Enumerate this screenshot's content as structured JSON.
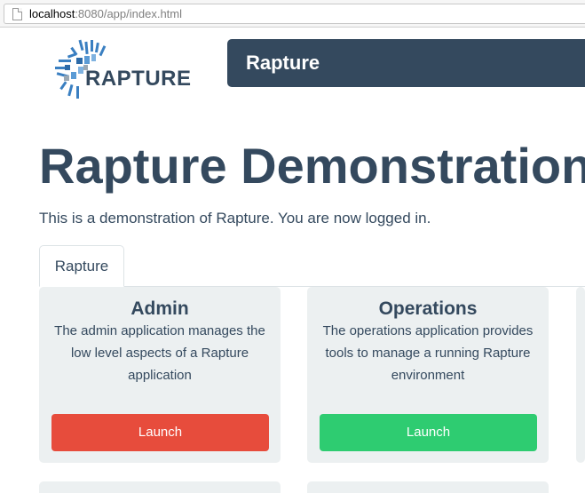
{
  "browser": {
    "url_host": "localhost",
    "url_rest": ":8080/app/index.html"
  },
  "header": {
    "logo_text": "RAPTURE",
    "brand": "Rapture"
  },
  "main": {
    "title": "Rapture Demonstration",
    "lead": "This is a demonstration of Rapture. You are now logged in.",
    "tabs": [
      {
        "label": "Rapture",
        "active": true
      }
    ],
    "cards": [
      {
        "title": "Admin",
        "description": "The admin application manages the low level aspects of a Rapture application",
        "button_label": "Launch",
        "button_color": "#e74c3c"
      },
      {
        "title": "Operations",
        "description": "The operations application provides tools to manage a running Rapture environment",
        "button_label": "Launch",
        "button_color": "#2ecc71"
      }
    ]
  },
  "colors": {
    "primary": "#34495e",
    "card_bg": "#ecf0f1",
    "danger": "#e74c3c",
    "success": "#2ecc71"
  }
}
